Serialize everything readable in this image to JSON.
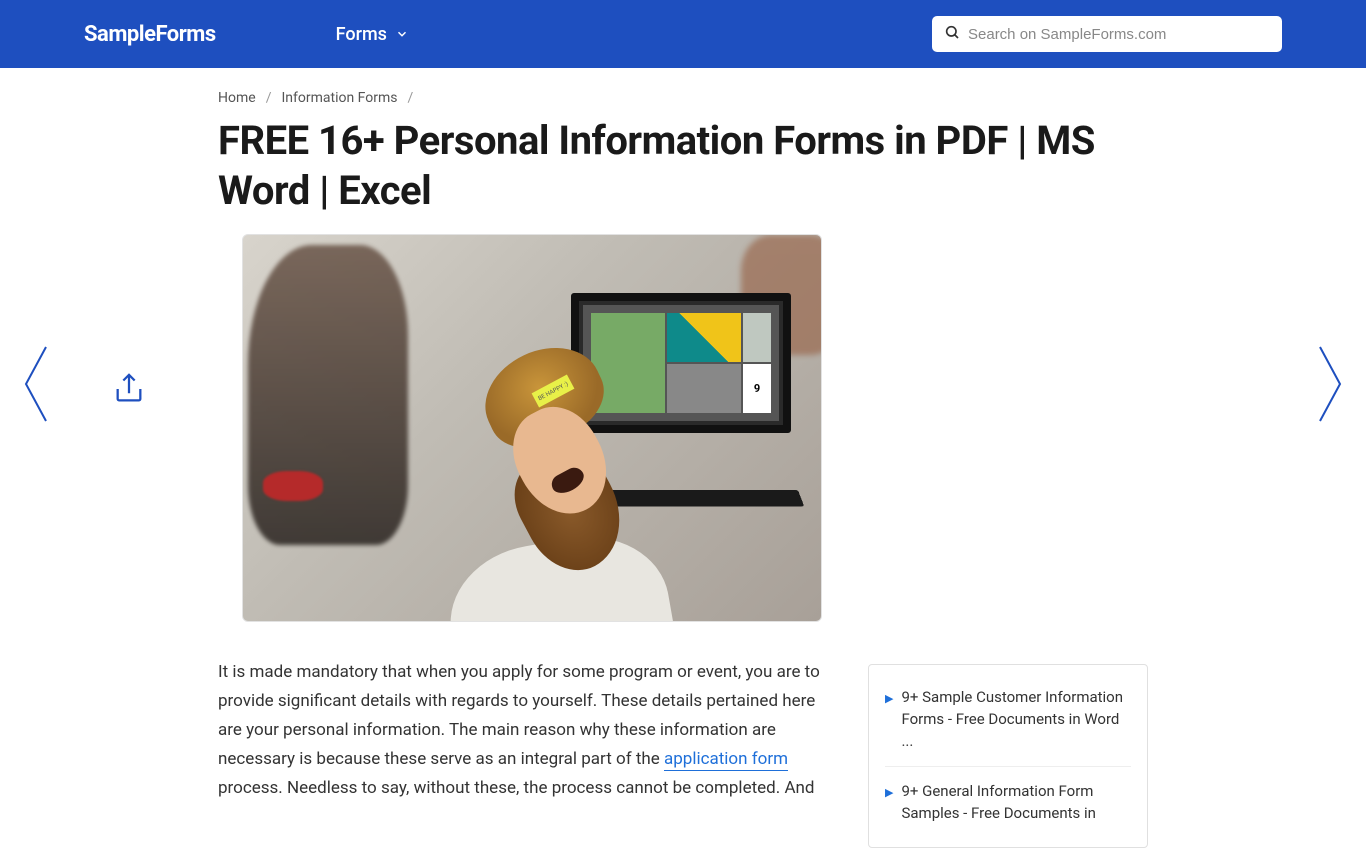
{
  "header": {
    "logo": "SampleForms",
    "nav_forms": "Forms",
    "search_placeholder": "Search on SampleForms.com"
  },
  "breadcrumb": {
    "home": "Home",
    "cat": "Information Forms"
  },
  "title": "FREE 16+ Personal Information Forms in PDF | MS Word | Excel",
  "hero": {
    "sticky": "BE HAPPY :)",
    "tile_num": "9"
  },
  "body": {
    "p1a": "It is made mandatory that when you apply for some program or event, you are to provide significant details with regards to yourself. These details pertained here are your personal information. The main reason why these information are necessary is because these serve as an integral part of the ",
    "link1": "application form",
    "p1b": " process. Needless to say, without these, the process cannot be completed. And"
  },
  "related": {
    "items": [
      "9+ Sample Customer Information Forms - Free Documents in Word ...",
      "9+ General Information Form Samples - Free Documents in"
    ]
  }
}
